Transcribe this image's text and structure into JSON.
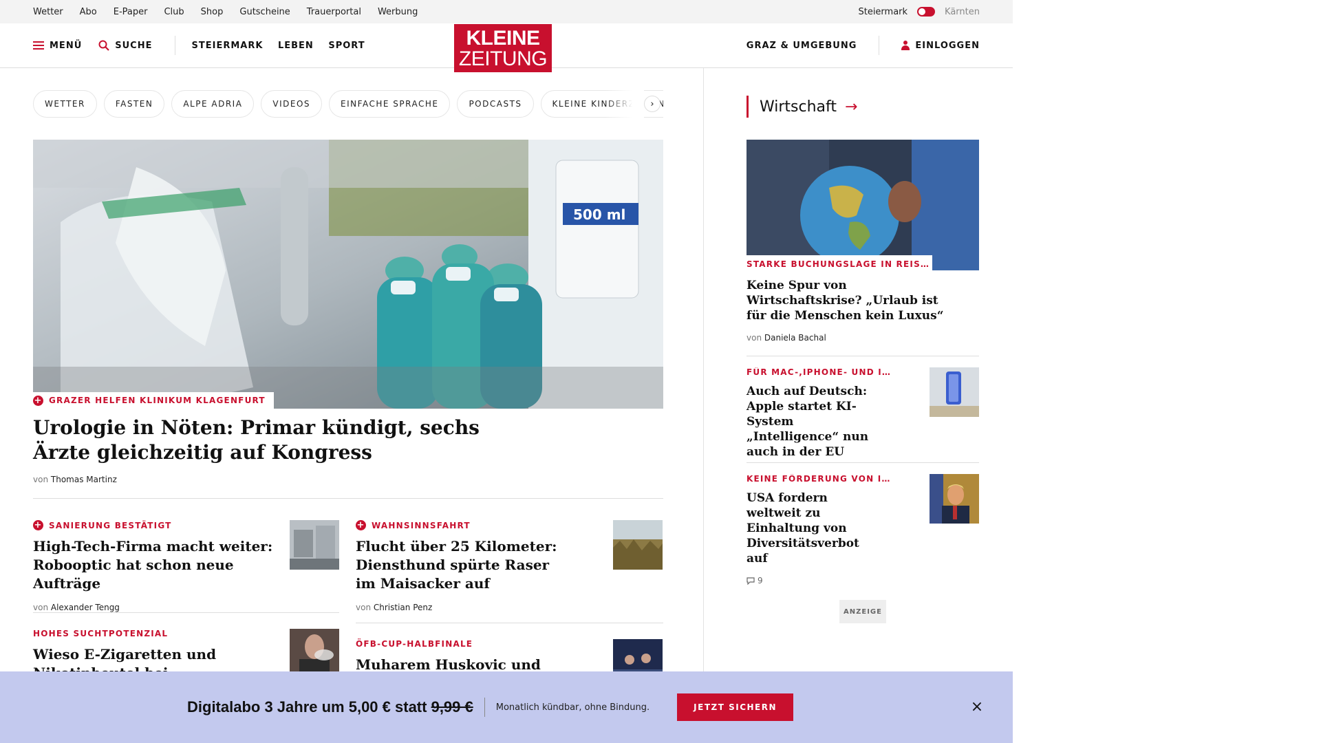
{
  "topbar": {
    "links": [
      "Wetter",
      "Abo",
      "E-Paper",
      "Club",
      "Shop",
      "Gutscheine",
      "Trauerportal",
      "Werbung"
    ],
    "region_active": "Steiermark",
    "region_inactive": "Kärnten"
  },
  "header": {
    "menu_label": "MENÜ",
    "search_label": "SUCHE",
    "nav": [
      "STEIERMARK",
      "LEBEN",
      "SPORT"
    ],
    "logo_line1": "KLEINE",
    "logo_line2": "ZEITUNG",
    "local_label": "GRAZ & UMGEBUNG",
    "login_label": "EINLOGGEN"
  },
  "chips": [
    "WETTER",
    "FASTEN",
    "ALPE ADRIA",
    "VIDEOS",
    "EINFACHE SPRACHE",
    "PODCASTS",
    "KLEINE KINDERZEITUNG"
  ],
  "chips_next": "›",
  "hero": {
    "kicker": "GRAZER HELFEN KLINIKUM KLAGENFURT",
    "title": "Urologie in Nöten: Primar kündigt, sechs Ärzte gleichzeitig auf Kongress",
    "by_prefix": "von",
    "author": "Thomas Martinz",
    "image_label": "500 ml"
  },
  "articles": [
    {
      "kicker": "SANIERUNG BESTÄTIGT",
      "premium": true,
      "title": "High-Tech-Firma macht weiter: Robooptic hat schon neue Aufträge",
      "by_prefix": "von",
      "author": "Alexander Tengg"
    },
    {
      "kicker": "WAHNSINNSFAHRT",
      "premium": true,
      "title": "Flucht über 25 Kilometer: Diensthund spürte Raser im Maisacker auf",
      "by_prefix": "von",
      "author": "Christian Penz"
    },
    {
      "kicker": "HOHES SUCHTPOTENZIAL",
      "premium": false,
      "title": "Wieso E-Zigaretten und Nikotinbeutel bei Jugendlichen"
    },
    {
      "kicker": "ÖFB-CUP-HALBFINALE",
      "premium": false,
      "title": "Muharem Huskovic und Elias"
    }
  ],
  "sidebar": {
    "heading": "Wirtschaft",
    "arrow": "→",
    "lead": {
      "kicker": "STARKE BUCHUNGSLAGE IN REISEB...",
      "title": "Keine Spur von Wirtschaftskrise? „Urlaub ist für die Menschen kein Luxus“",
      "by_prefix": "von",
      "author": "Daniela Bachal"
    },
    "items": [
      {
        "kicker": "FÜR MAC-,IPHONE- UND IPAD...",
        "title": "Auch auf Deutsch: Apple startet KI-System „Intelligence“ nun auch in der EU"
      },
      {
        "kicker": "KEINE FÖRDERUNG VON INKL...",
        "title": "USA fordern weltweit zu Einhaltung von Diversitätsverbot auf",
        "comments": "9"
      }
    ],
    "ad_label": "ANZEIGE"
  },
  "banner": {
    "main": "Digitalabo 3 Jahre um 5,00 € statt ",
    "old_price": "9,99 €",
    "sub": "Monatlich kündbar, ohne Bindung.",
    "cta": "JETZT SICHERN",
    "close": "×"
  },
  "colors": {
    "accent": "#c8102e",
    "banner_bg": "#c3c9ee",
    "topbar_bg": "#f3f3f3"
  }
}
